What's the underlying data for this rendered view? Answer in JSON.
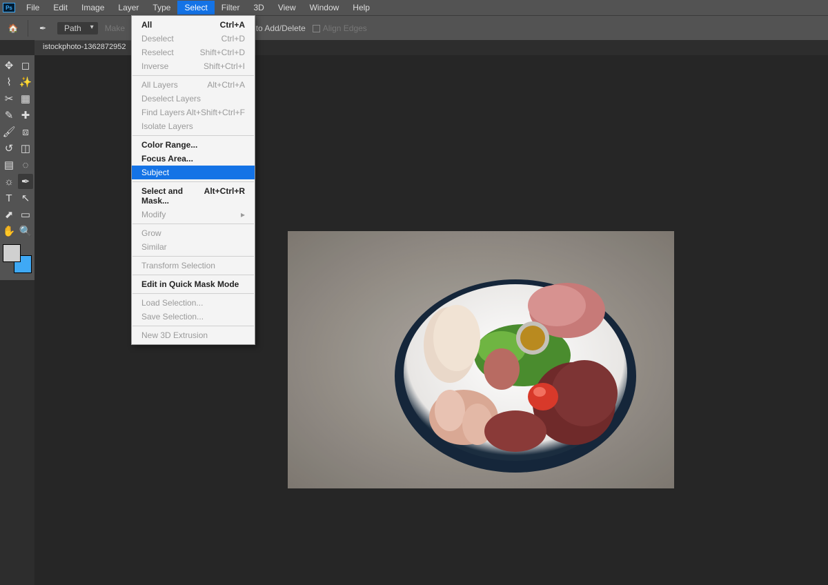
{
  "menubar": {
    "items": [
      "File",
      "Edit",
      "Image",
      "Layer",
      "Type",
      "Select",
      "Filter",
      "3D",
      "View",
      "Window",
      "Help"
    ],
    "open_index": 5
  },
  "optionsbar": {
    "mode_label": "Path",
    "make_label": "Make",
    "auto_add_delete": "Auto Add/Delete",
    "align_edges": "Align Edges",
    "auto_add_checked": true
  },
  "document_tab": "istockphoto-1362872952",
  "dropdown": {
    "groups": [
      [
        {
          "label": "All",
          "shortcut": "Ctrl+A",
          "bold": true
        },
        {
          "label": "Deselect",
          "shortcut": "Ctrl+D",
          "disabled": true
        },
        {
          "label": "Reselect",
          "shortcut": "Shift+Ctrl+D",
          "disabled": true
        },
        {
          "label": "Inverse",
          "shortcut": "Shift+Ctrl+I",
          "disabled": true
        }
      ],
      [
        {
          "label": "All Layers",
          "shortcut": "Alt+Ctrl+A",
          "disabled": true
        },
        {
          "label": "Deselect Layers",
          "disabled": true
        },
        {
          "label": "Find Layers",
          "shortcut": "Alt+Shift+Ctrl+F",
          "disabled": true
        },
        {
          "label": "Isolate Layers",
          "disabled": true
        }
      ],
      [
        {
          "label": "Color Range...",
          "bold": true
        },
        {
          "label": "Focus Area...",
          "bold": true
        },
        {
          "label": "Subject",
          "highlighted": true
        }
      ],
      [
        {
          "label": "Select and Mask...",
          "shortcut": "Alt+Ctrl+R",
          "bold": true
        },
        {
          "label": "Modify",
          "disabled": true,
          "submenu": true
        }
      ],
      [
        {
          "label": "Grow",
          "disabled": true
        },
        {
          "label": "Similar",
          "disabled": true
        }
      ],
      [
        {
          "label": "Transform Selection",
          "disabled": true
        }
      ],
      [
        {
          "label": "Edit in Quick Mask Mode",
          "bold": true
        }
      ],
      [
        {
          "label": "Load Selection...",
          "disabled": true
        },
        {
          "label": "Save Selection...",
          "disabled": true
        }
      ],
      [
        {
          "label": "New 3D Extrusion",
          "disabled": true
        }
      ]
    ]
  },
  "tools": [
    "move",
    "marquee",
    "lasso",
    "magic-wand",
    "crop",
    "frame",
    "eyedropper",
    "patch",
    "brush",
    "stamp",
    "history-brush",
    "eraser",
    "gradient",
    "blur",
    "dodge",
    "pen",
    "type",
    "path-select",
    "direct-select",
    "rectangle",
    "hand",
    "zoom",
    "color-swatch",
    "quick-mask"
  ],
  "colors": {
    "fg": "#d0d0d0",
    "bg": "#3fa9f5"
  }
}
